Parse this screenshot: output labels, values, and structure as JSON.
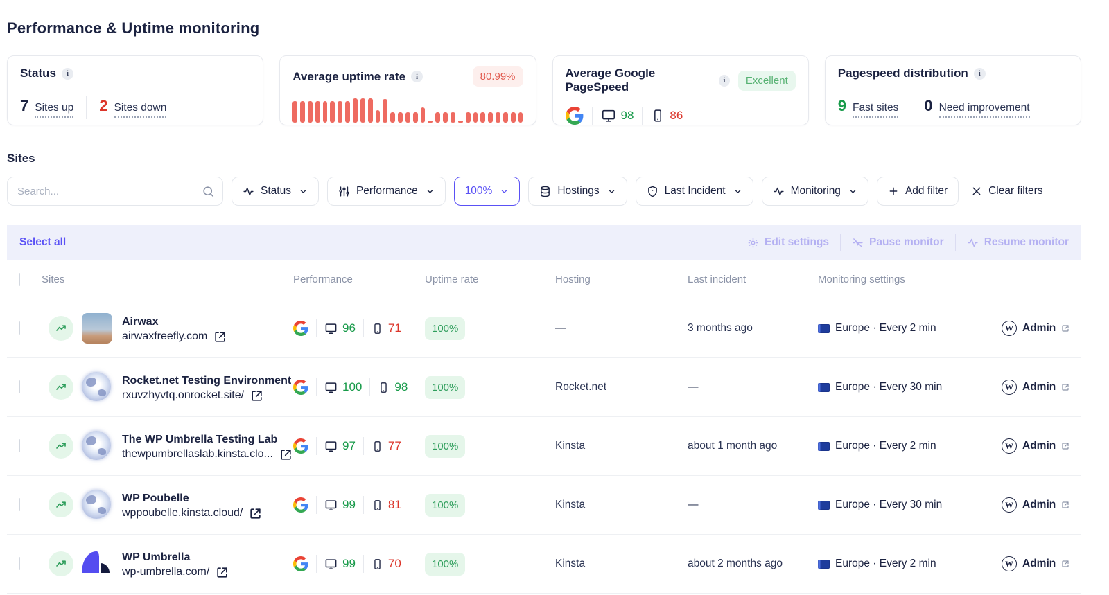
{
  "page": {
    "title": "Performance & Uptime monitoring"
  },
  "cards": {
    "status": {
      "title": "Status",
      "up_count": "7",
      "up_label": "Sites up",
      "down_count": "2",
      "down_label": "Sites down"
    },
    "uptime": {
      "title": "Average uptime rate",
      "badge": "80.99%"
    },
    "pagespeed": {
      "title": "Average Google PageSpeed",
      "badge": "Excellent",
      "desktop_score": "98",
      "mobile_score": "86"
    },
    "distribution": {
      "title": "Pagespeed distribution",
      "fast_count": "9",
      "fast_label": "Fast sites",
      "improve_count": "0",
      "improve_label": "Need improvement"
    }
  },
  "chart_data": {
    "type": "bar",
    "title": "Average uptime rate sparkline",
    "ylim": [
      0,
      100
    ],
    "values": [
      78,
      78,
      78,
      78,
      78,
      78,
      78,
      78,
      88,
      88,
      88,
      45,
      85,
      38,
      38,
      38,
      38,
      55,
      7,
      38,
      38,
      38,
      7,
      38,
      38,
      38,
      38,
      38,
      38,
      38,
      38
    ],
    "bar_color": "#ee6b61",
    "grid": false,
    "legend": "none"
  },
  "sites_section": {
    "title": "Sites",
    "search_placeholder": "Search...",
    "filters": {
      "status": {
        "label": "Status"
      },
      "performance": {
        "label": "Performance"
      },
      "value": {
        "label": "100%"
      },
      "hostings": {
        "label": "Hostings"
      },
      "last_incident": {
        "label": "Last Incident"
      },
      "monitoring": {
        "label": "Monitoring"
      }
    },
    "add_filter": "Add filter",
    "clear_filters": "Clear filters"
  },
  "bulk_bar": {
    "select_all": "Select all",
    "edit_settings": "Edit settings",
    "pause_monitor": "Pause monitor",
    "resume_monitor": "Resume monitor"
  },
  "table": {
    "headers": [
      "Sites",
      "Performance",
      "Uptime rate",
      "Hosting",
      "Last incident",
      "Monitoring settings"
    ],
    "rows": [
      {
        "name": "Airwax",
        "url": "airwaxfreefly.com",
        "favicon": "photo",
        "desktop_score": "96",
        "mobile_score": "71",
        "uptime": "100%",
        "hosting": "—",
        "last_incident": "3 months ago",
        "monitoring": "Europe · Every 2 min",
        "admin": "Admin"
      },
      {
        "name": "Rocket.net Testing Environment",
        "url": "rxuvzhyvtq.onrocket.site/",
        "favicon": "globe",
        "desktop_score": "100",
        "mobile_score": "98",
        "uptime": "100%",
        "hosting": "Rocket.net",
        "last_incident": "—",
        "monitoring": "Europe · Every 30 min",
        "admin": "Admin"
      },
      {
        "name": "The WP Umbrella Testing Lab",
        "url": "thewpumbrellaslab.kinsta.clo...",
        "favicon": "globe",
        "desktop_score": "97",
        "mobile_score": "77",
        "uptime": "100%",
        "hosting": "Kinsta",
        "last_incident": "about 1 month ago",
        "monitoring": "Europe · Every 2 min",
        "admin": "Admin"
      },
      {
        "name": "WP Poubelle",
        "url": "wppoubelle.kinsta.cloud/",
        "favicon": "globe",
        "desktop_score": "99",
        "mobile_score": "81",
        "uptime": "100%",
        "hosting": "Kinsta",
        "last_incident": "—",
        "monitoring": "Europe · Every 30 min",
        "admin": "Admin"
      },
      {
        "name": "WP Umbrella",
        "url": "wp-umbrella.com/",
        "favicon": "umbrella",
        "desktop_score": "99",
        "mobile_score": "70",
        "uptime": "100%",
        "hosting": "Kinsta",
        "last_incident": "about 2 months ago",
        "monitoring": "Europe · Every 2 min",
        "admin": "Admin"
      }
    ]
  },
  "colors": {
    "accent_indigo": "#5a51f5",
    "bar_red": "#ee6b61",
    "score_green": "#179a49",
    "score_red": "#dc362b",
    "uptime_badge_bg": "#e5f6ea",
    "bulk_bar_bg": "#eef0fb"
  }
}
